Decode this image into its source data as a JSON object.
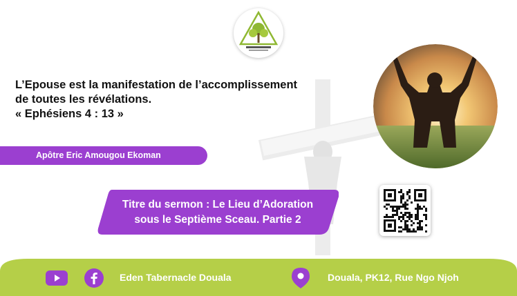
{
  "quote": {
    "line1": "L’Epouse est la manifestation de l’accomplissement",
    "line2": "de toutes les révélations.",
    "line3": "« Ephésiens 4 : 13 »"
  },
  "author": {
    "name": "Apôtre Eric Amougou Ekoman"
  },
  "sermon": {
    "line1": "Titre du sermon : Le Lieu d’Adoration",
    "line2": "sous le Septième Sceau. Partie 2"
  },
  "footer": {
    "church_name": "Eden Tabernacle Douala",
    "address": "Douala, PK12, Rue Ngo Njoh"
  },
  "icons": {
    "youtube": "youtube-icon",
    "facebook": "facebook-icon",
    "location": "location-pin-icon",
    "qr": "qr-code",
    "logo": "church-logo"
  },
  "colors": {
    "purple": "#9b3fd0",
    "green": "#b5cf48",
    "cross": "#eeeeee"
  }
}
